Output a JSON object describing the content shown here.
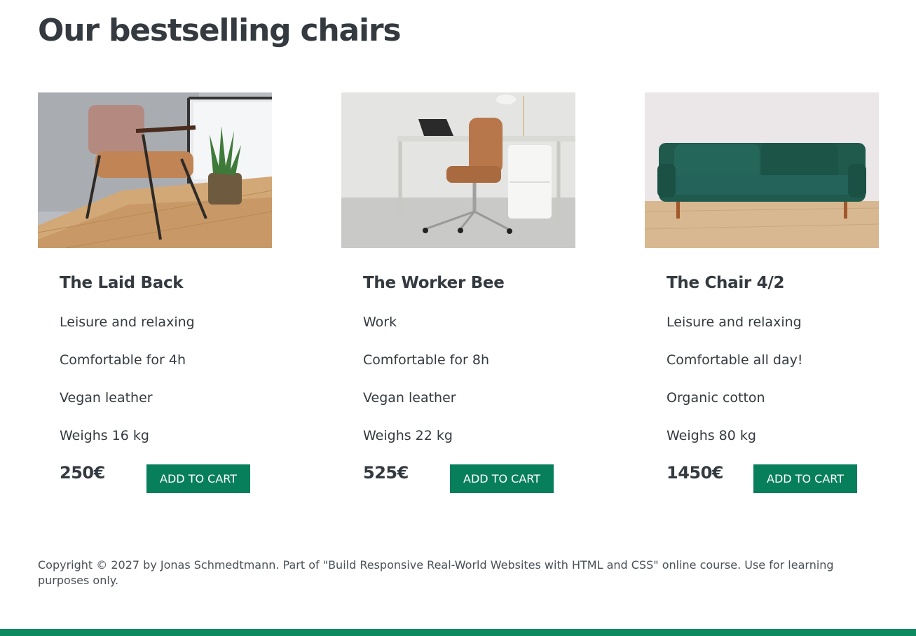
{
  "page": {
    "title": "Our bestselling chairs",
    "accent_color": "#087f5b"
  },
  "chairs": [
    {
      "image_icon": "armchair-photo",
      "name": "The Laid Back",
      "features": [
        "Leisure and relaxing",
        "Comfortable for 4h",
        "Vegan leather",
        "Weighs 16 kg"
      ],
      "price": "250€",
      "button_label": "ADD TO CART"
    },
    {
      "image_icon": "office-chair-photo",
      "name": "The Worker Bee",
      "features": [
        "Work",
        "Comfortable for 8h",
        "Vegan leather",
        "Weighs 22 kg"
      ],
      "price": "525€",
      "button_label": "ADD TO CART"
    },
    {
      "image_icon": "sofa-photo",
      "name": "The Chair 4/2",
      "features": [
        "Leisure and relaxing",
        "Comfortable all day!",
        "Organic cotton",
        "Weighs 80 kg"
      ],
      "price": "1450€",
      "button_label": "ADD TO CART"
    }
  ],
  "footer": {
    "copyright": "Copyright © 2027 by Jonas Schmedtmann. Part of \"Build Responsive Real-World Websites with HTML and CSS\" online course. Use for learning purposes only."
  }
}
